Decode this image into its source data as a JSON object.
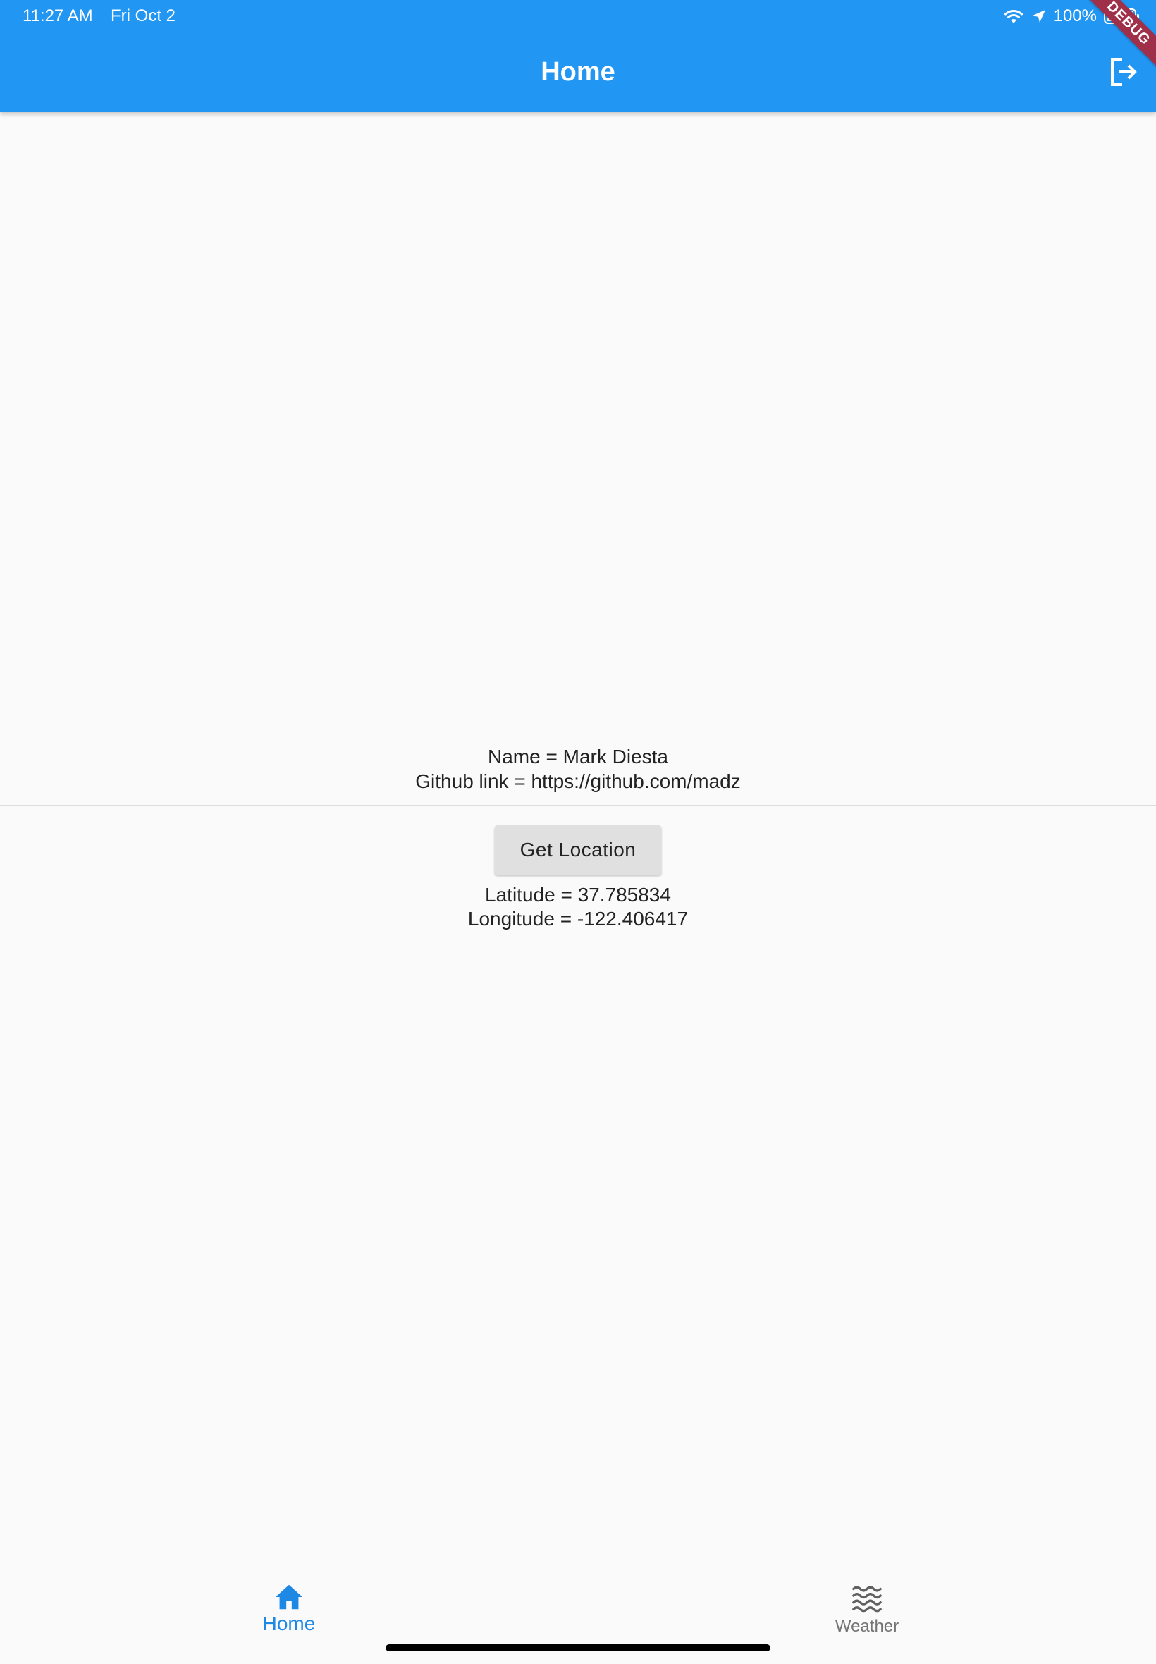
{
  "status_bar": {
    "time": "11:27 AM",
    "date": "Fri Oct 2",
    "battery": "100%",
    "debug_label": "DEBUG"
  },
  "appbar": {
    "title": "Home",
    "logout_icon": "logout-icon"
  },
  "profile": {
    "name_line": "Name = Mark Diesta",
    "github_line": "Github link = https://github.com/madz"
  },
  "location": {
    "button_label": "Get Location",
    "latitude_line": "Latitude = 37.785834",
    "longitude_line": "Longitude = -122.406417"
  },
  "bottom_nav": {
    "items": [
      {
        "label": "Home",
        "icon": "home-icon",
        "active": true
      },
      {
        "label": "Weather",
        "icon": "waves-icon",
        "active": false
      }
    ]
  },
  "colors": {
    "primary": "#2196f3",
    "active_nav": "#1e88e5",
    "inactive_nav": "#757575",
    "background": "#fafafa",
    "debug_ribbon": "#a0304a"
  }
}
